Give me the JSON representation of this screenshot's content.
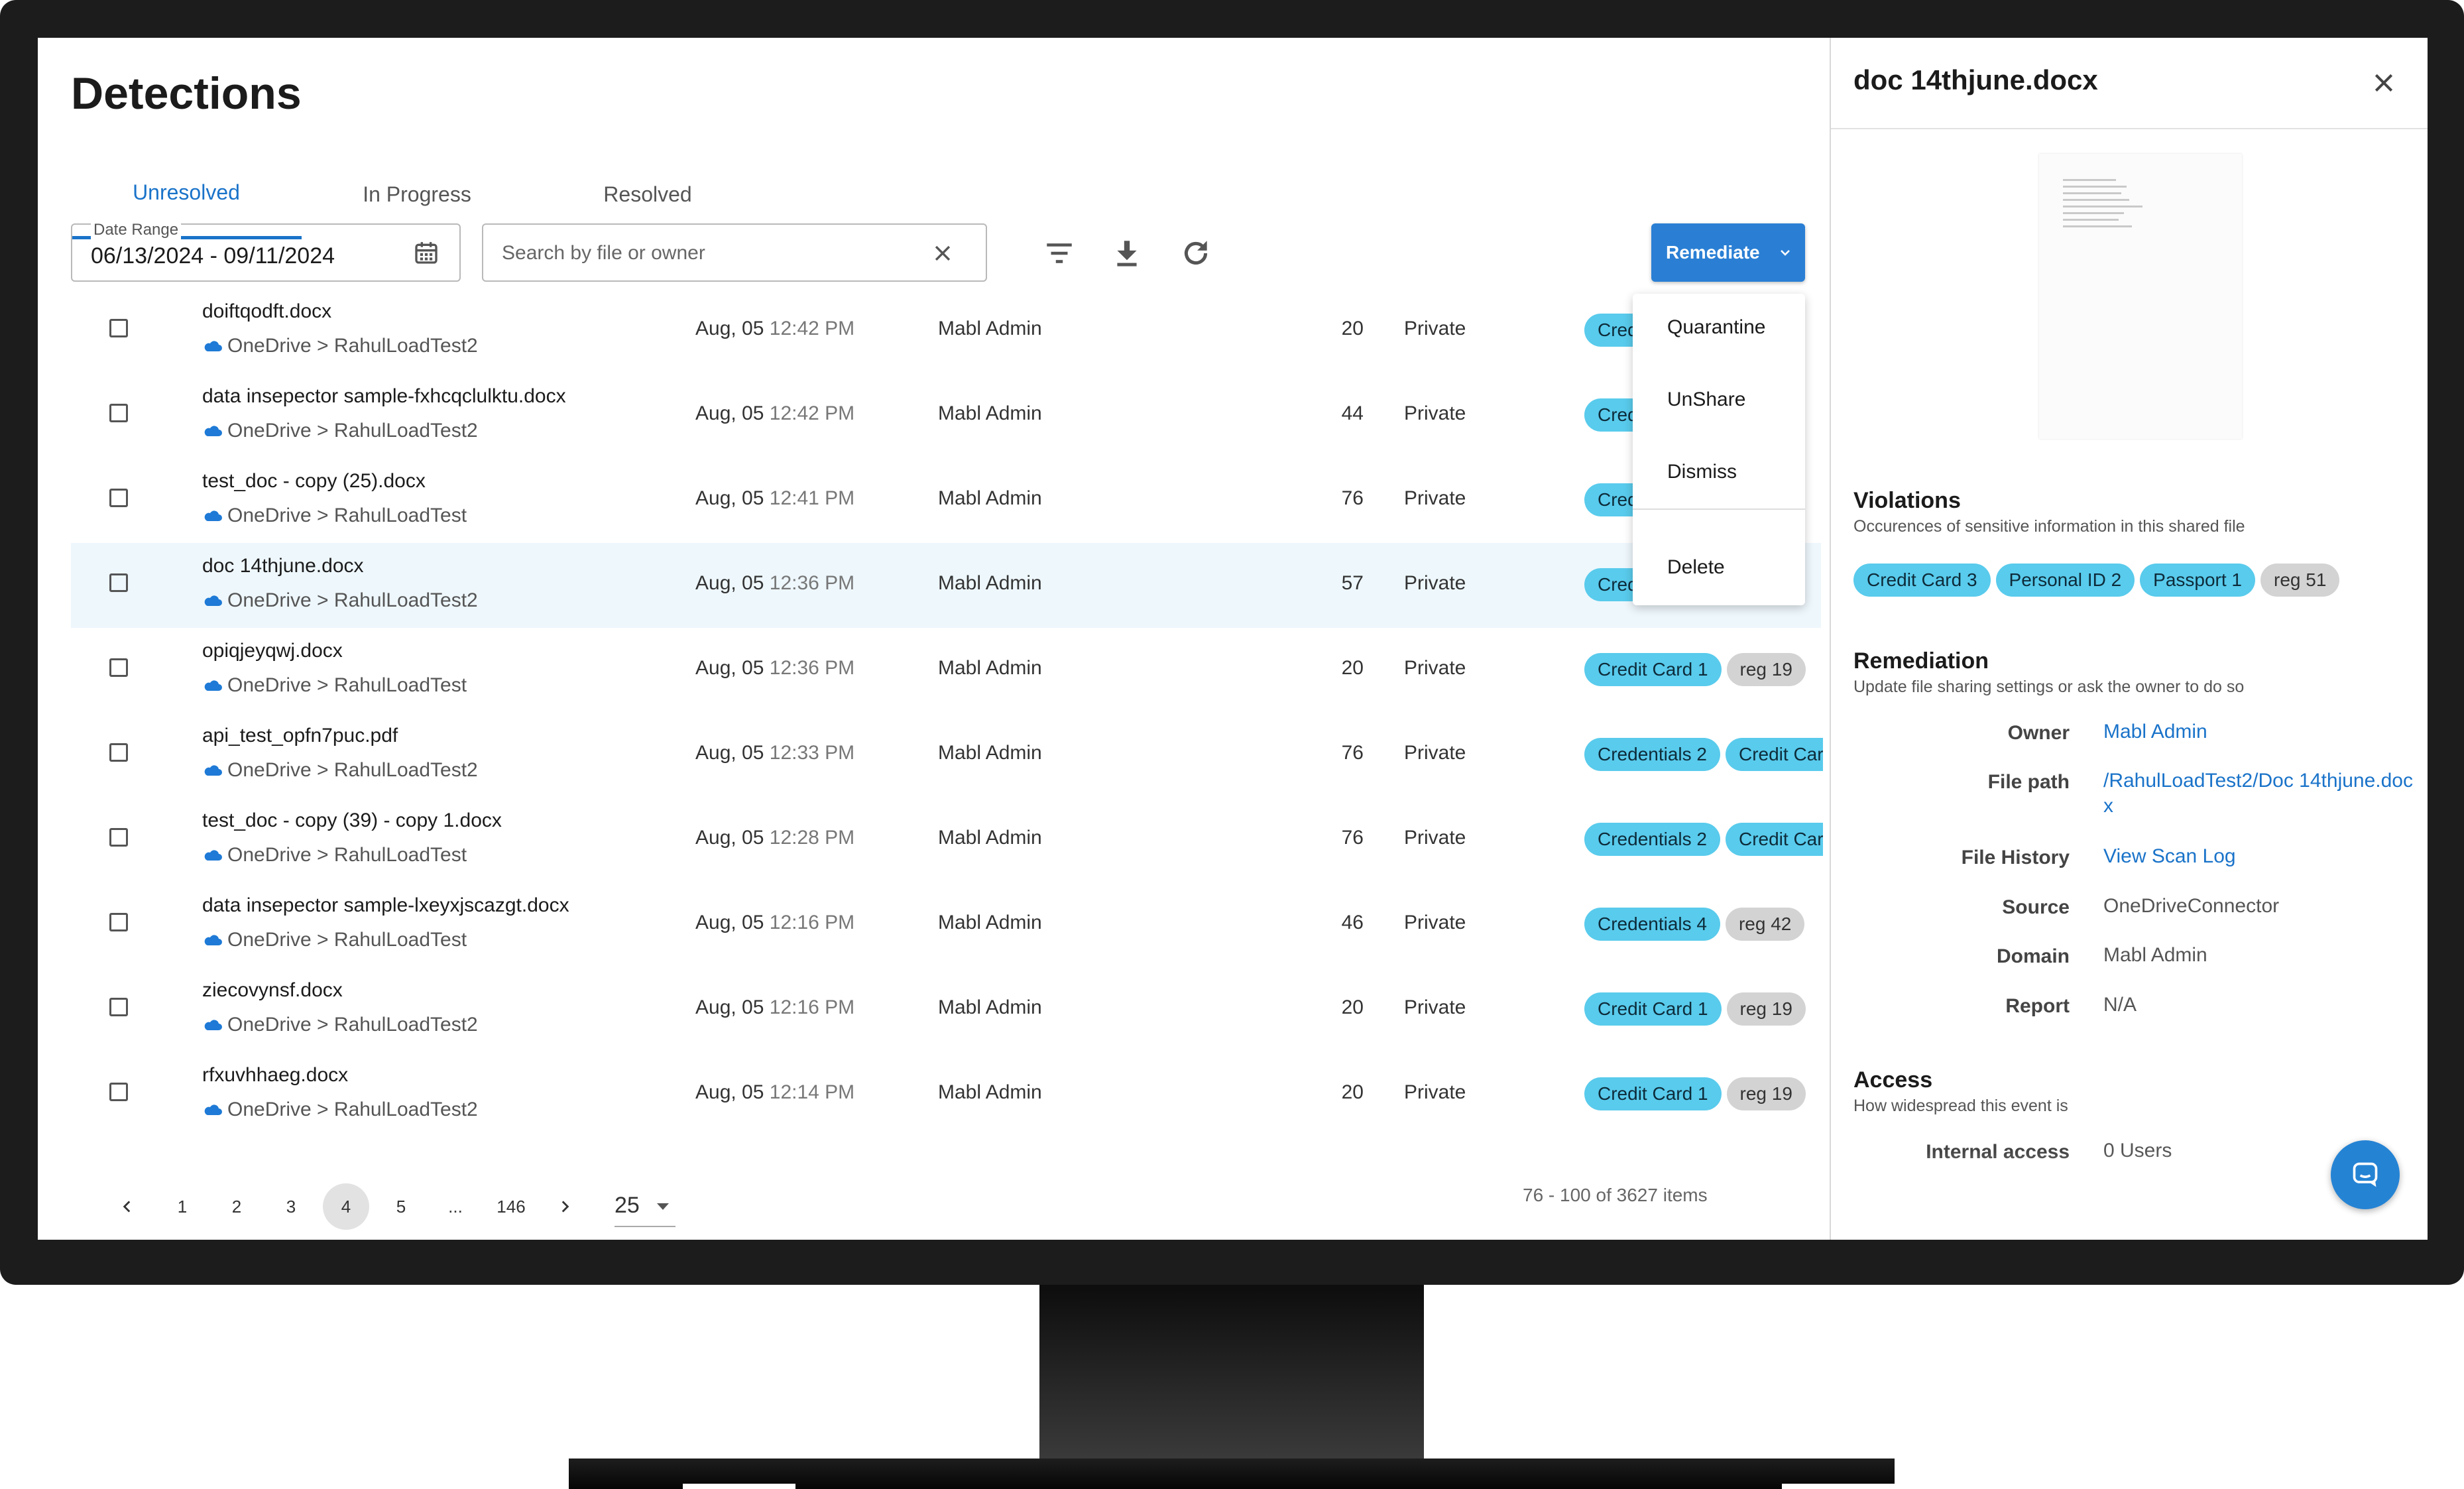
{
  "page": {
    "title": "Detections"
  },
  "tabs": [
    {
      "label": "Unresolved",
      "active": true
    },
    {
      "label": "In Progress",
      "active": false
    },
    {
      "label": "Resolved",
      "active": false
    }
  ],
  "filters": {
    "date_label": "Date Range",
    "date_value": "06/13/2024 - 09/11/2024",
    "search_placeholder": "Search by file or owner"
  },
  "toolbar": {
    "icons": [
      "filter-icon",
      "download-icon",
      "refresh-icon"
    ],
    "remediate_label": "Remediate"
  },
  "remediate_menu": [
    "Quarantine",
    "UnShare",
    "Dismiss",
    "Delete"
  ],
  "rows": [
    {
      "name": "doiftqodft.docx",
      "path": "OneDrive > RahulLoadTest2",
      "date": "Aug, 05",
      "time": "12:42 PM",
      "owner": "Mabl Admin",
      "count": "20",
      "visibility": "Private",
      "chips": [
        {
          "label": "Credit Card 1",
          "type": "blue"
        }
      ]
    },
    {
      "name": "data insepector sample-fxhcqclulktu.docx",
      "path": "OneDrive > RahulLoadTest2",
      "date": "Aug, 05",
      "time": "12:42 PM",
      "owner": "Mabl Admin",
      "count": "44",
      "visibility": "Private",
      "chips": [
        {
          "label": "Credit Card 1",
          "type": "blue"
        }
      ]
    },
    {
      "name": "test_doc - copy (25).docx",
      "path": "OneDrive > RahulLoadTest",
      "date": "Aug, 05",
      "time": "12:41 PM",
      "owner": "Mabl Admin",
      "count": "76",
      "visibility": "Private",
      "chips": [
        {
          "label": "Credentials 2",
          "type": "blue"
        }
      ]
    },
    {
      "name": "doc 14thjune.docx",
      "path": "OneDrive > RahulLoadTest2",
      "date": "Aug, 05",
      "time": "12:36 PM",
      "owner": "Mabl Admin",
      "count": "57",
      "visibility": "Private",
      "chips": [
        {
          "label": "Credit Card 3",
          "type": "blue"
        }
      ],
      "selected": true
    },
    {
      "name": "opiqjeyqwj.docx",
      "path": "OneDrive > RahulLoadTest",
      "date": "Aug, 05",
      "time": "12:36 PM",
      "owner": "Mabl Admin",
      "count": "20",
      "visibility": "Private",
      "chips": [
        {
          "label": "Credit Card 1",
          "type": "blue"
        },
        {
          "label": "reg 19",
          "type": "grey"
        }
      ]
    },
    {
      "name": "api_test_opfn7puc.pdf",
      "path": "OneDrive > RahulLoadTest2",
      "date": "Aug, 05",
      "time": "12:33 PM",
      "owner": "Mabl Admin",
      "count": "76",
      "visibility": "Private",
      "chips": [
        {
          "label": "Credentials 2",
          "type": "blue"
        },
        {
          "label": "Credit Card",
          "type": "blue"
        }
      ]
    },
    {
      "name": "test_doc - copy (39) - copy 1.docx",
      "path": "OneDrive > RahulLoadTest",
      "date": "Aug, 05",
      "time": "12:28 PM",
      "owner": "Mabl Admin",
      "count": "76",
      "visibility": "Private",
      "chips": [
        {
          "label": "Credentials 2",
          "type": "blue"
        },
        {
          "label": "Credit Card",
          "type": "blue"
        }
      ]
    },
    {
      "name": "data insepector sample-lxeyxjscazgt.docx",
      "path": "OneDrive > RahulLoadTest",
      "date": "Aug, 05",
      "time": "12:16 PM",
      "owner": "Mabl Admin",
      "count": "46",
      "visibility": "Private",
      "chips": [
        {
          "label": "Credentials 4",
          "type": "blue"
        },
        {
          "label": "reg 42",
          "type": "grey"
        }
      ]
    },
    {
      "name": "ziecovynsf.docx",
      "path": "OneDrive > RahulLoadTest2",
      "date": "Aug, 05",
      "time": "12:16 PM",
      "owner": "Mabl Admin",
      "count": "20",
      "visibility": "Private",
      "chips": [
        {
          "label": "Credit Card 1",
          "type": "blue"
        },
        {
          "label": "reg 19",
          "type": "grey"
        }
      ]
    },
    {
      "name": "rfxuvhhaeg.docx",
      "path": "OneDrive > RahulLoadTest2",
      "date": "Aug, 05",
      "time": "12:14 PM",
      "owner": "Mabl Admin",
      "count": "20",
      "visibility": "Private",
      "chips": [
        {
          "label": "Credit Card 1",
          "type": "blue"
        },
        {
          "label": "reg 19",
          "type": "grey"
        }
      ]
    }
  ],
  "pagination": {
    "pages": [
      "1",
      "2",
      "3",
      "4",
      "5",
      "...",
      "146"
    ],
    "active_page": "4",
    "page_size": "25",
    "summary": "76 - 100 of 3627 items"
  },
  "side_panel": {
    "title": "doc 14thjune.docx",
    "violations_title": "Violations",
    "violations_subtitle": "Occurences of sensitive information in this shared file",
    "violations": [
      {
        "label": "Credit Card 3",
        "type": "blue"
      },
      {
        "label": "Personal ID 2",
        "type": "blue"
      },
      {
        "label": "Passport 1",
        "type": "blue"
      },
      {
        "label": "reg 51",
        "type": "grey"
      }
    ],
    "remediation_title": "Remediation",
    "remediation_subtitle": "Update file sharing settings or ask the owner to do so",
    "details": [
      {
        "key": "Owner",
        "value": "Mabl Admin",
        "link": true
      },
      {
        "key": "File path",
        "value": "/RahulLoadTest2/Doc 14thjune.docx",
        "link": true
      },
      {
        "key": "File History",
        "value": "View Scan Log",
        "link": true
      },
      {
        "key": "Source",
        "value": "OneDriveConnector",
        "link": false
      },
      {
        "key": "Domain",
        "value": "Mabl Admin",
        "link": false
      },
      {
        "key": "Report",
        "value": "N/A",
        "link": false
      }
    ],
    "access_title": "Access",
    "access_subtitle": "How widespread this event is",
    "internal_access_label": "Internal access",
    "internal_access_value": "0 Users"
  },
  "colors": {
    "accent": "#2a7fd4",
    "chip_blue": "#59cbec",
    "chip_grey": "#d3d3d3",
    "link": "#1a73c9"
  }
}
